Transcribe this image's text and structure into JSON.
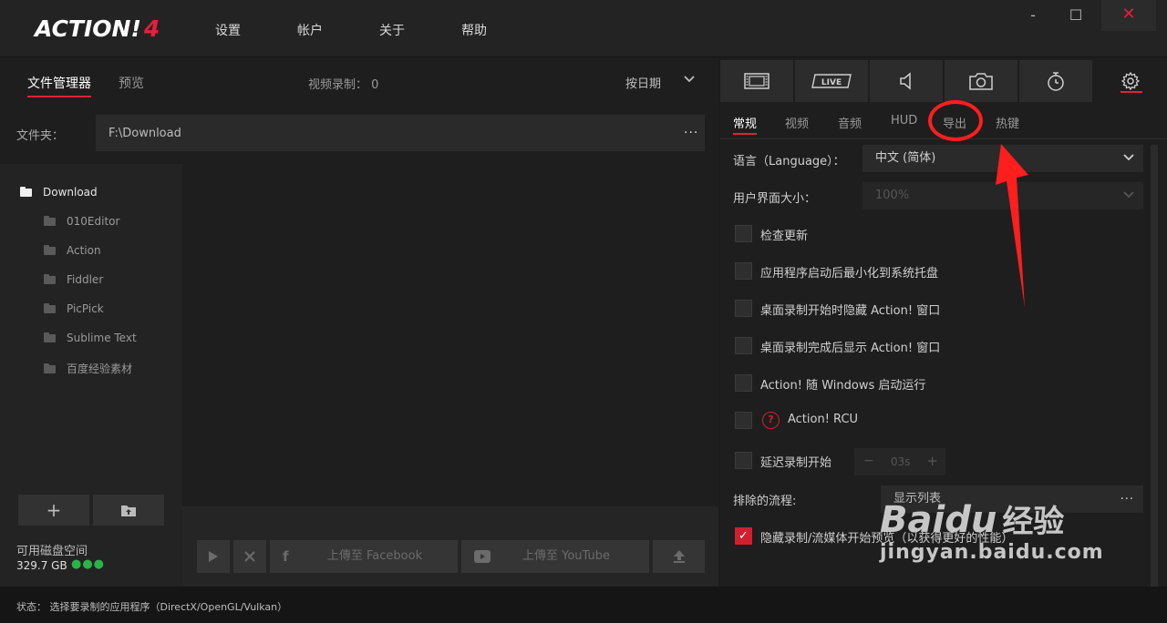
{
  "app": {
    "logo": "ACTION!",
    "logo_version": "4",
    "menu": [
      "设置",
      "帐户",
      "关于",
      "帮助"
    ],
    "window_minimize": "-",
    "window_maximize": "☐",
    "window_close": "✕"
  },
  "left": {
    "tabs": [
      "文件管理器",
      "预览"
    ],
    "video_count_label": "视频录制：",
    "video_count": "0",
    "sort_label": "按日期",
    "folder_label": "文件夹：",
    "folder_value": "F:\\Download",
    "folder_more": "...",
    "tree": {
      "root": "Download",
      "children": [
        "010Editor",
        "Action",
        "Fiddler",
        "PicPick",
        "Sublime Text",
        "百度经验素材"
      ]
    },
    "add_button": "+",
    "disk_label": "可用磁盘空间",
    "disk_value": "329.7 GB",
    "disk_dots": "●●●",
    "upload_facebook": "上傳至 Facebook",
    "upload_youtube": "上傳至 YouTube"
  },
  "right": {
    "subtabs": [
      "常规",
      "视频",
      "音频",
      "HUD",
      "导出",
      "热键"
    ],
    "language_label": "语言（Language）：",
    "language_value": "中文 (简体)",
    "ui_size_label": "用户界面大小：",
    "ui_size_value": "100%",
    "checkboxes": [
      "检查更新",
      "应用程序启动后最小化到系统托盘",
      "桌面录制开始时隐藏 Action! 窗口",
      "桌面录制完成后显示 Action! 窗口",
      "Action! 随 Windows 启动运行",
      "Action! RCU",
      "延迟录制开始"
    ],
    "rcu_help": "?",
    "delay_value": "03s",
    "excluded_label": "排除的流程:",
    "excluded_value": "显示列表",
    "excluded_more": "...",
    "hide_preview_label": "隐藏录制/流媒体开始预览（以获得更好的性能）",
    "hide_preview_checked": true
  },
  "status": {
    "text": "状态：  选择要录制的应用程序（DirectX/OpenGL/Vulkan）"
  },
  "watermark": {
    "brand": "Baidu",
    "suffix": "经验",
    "url": "jingyan.baidu.com"
  },
  "colors": {
    "accent": "#e0223a",
    "annotation": "#ff1e1e",
    "disk_ok": "#2bb34a"
  }
}
